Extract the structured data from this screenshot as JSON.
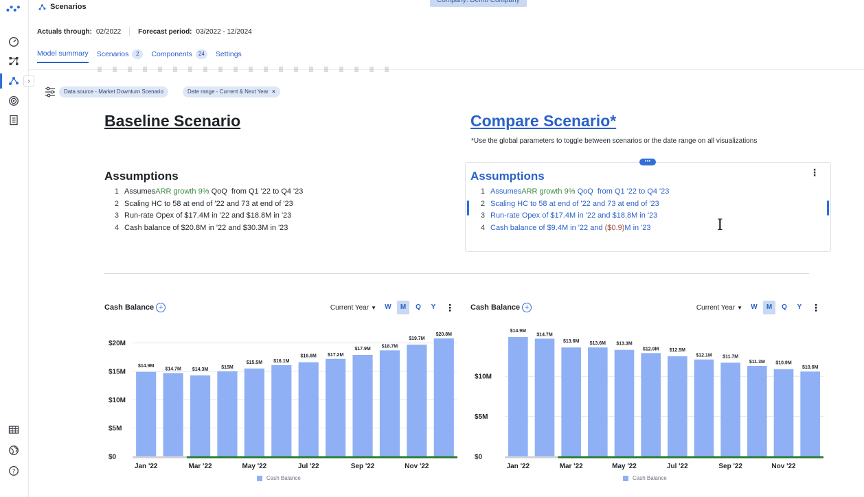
{
  "header": {
    "title": "Scenarios",
    "company_badge": "Company: Demo Company",
    "actuals_label": "Actuals through:",
    "actuals_value": "02/2022",
    "forecast_label": "Forecast period:",
    "forecast_value": "03/2022 - 12/2024"
  },
  "tabs": [
    {
      "label": "Model summary",
      "count": null
    },
    {
      "label": "Scenarios",
      "count": "2"
    },
    {
      "label": "Components",
      "count": "24"
    },
    {
      "label": "Settings",
      "count": null
    }
  ],
  "filters": {
    "chip1": "Data source - Market Downturn Scenario",
    "chip2": "Date range - Current & Next Year",
    "chip2_close": "×"
  },
  "baseline": {
    "title": "Baseline Scenario",
    "assumptions_title": "Assumptions",
    "items": [
      {
        "num": "1",
        "pre": "Assumes ",
        "highlight": "ARR growth 9%",
        "post": " QoQ  from Q1 '22 to Q4 '23"
      },
      {
        "num": "2",
        "text": "Scaling HC to 58 at end of '22 and 73 at end of '23"
      },
      {
        "num": "3",
        "text": "Run-rate Opex of $17.4M in '22 and $18.8M in '23"
      },
      {
        "num": "4",
        "text": "Cash balance of $20.8M in '22 and $30.3M in '23"
      }
    ]
  },
  "compare": {
    "title": "Compare Scenario*",
    "note": "*Use the global parameters to toggle between scenarios or the date range on all visualizations",
    "assumptions_title": "Assumptions",
    "items": [
      {
        "num": "1",
        "pre": "Assumes ",
        "highlight": "ARR growth 9%",
        "post": " QoQ  from Q1 '22 to Q4 '23"
      },
      {
        "num": "2",
        "text": "Scaling HC to 58 at end of '22 and 73 at end of '23"
      },
      {
        "num": "3",
        "text": "Run-rate Opex of $17.4M in '22 and $18.8M in '23"
      },
      {
        "num": "4",
        "pre": "Cash balance of $9.4M in '22 and ",
        "neg": "($0.9)",
        "post": "M in '23"
      }
    ],
    "handle_dots": "•••"
  },
  "chart_controls": {
    "range": "Current Year",
    "periods": [
      "W",
      "M",
      "Q",
      "Y"
    ],
    "active_period": "M"
  },
  "colors": {
    "bar": "#8fb0f5",
    "actuals_line": "#2e7d32",
    "accent": "#2a62c8"
  },
  "chart_data": [
    {
      "type": "bar",
      "title": "Cash Balance",
      "series": [
        {
          "name": "Cash Balance",
          "values": [
            14.9,
            14.7,
            14.3,
            15.0,
            15.5,
            16.1,
            16.6,
            17.2,
            17.9,
            18.7,
            19.7,
            20.8
          ]
        }
      ],
      "categories": [
        "Jan '22",
        "Feb '22",
        "Mar '22",
        "Apr '22",
        "May '22",
        "Jun '22",
        "Jul '22",
        "Aug '22",
        "Sep '22",
        "Oct '22",
        "Nov '22",
        "Dec '22"
      ],
      "x_tick_labels": [
        "Jan '22",
        "Mar '22",
        "May '22",
        "Jul '22",
        "Sep '22",
        "Nov '22"
      ],
      "data_labels": [
        "$14.9M",
        "$14.7M",
        "$14.3M",
        "$15M",
        "$15.5M",
        "$16.1M",
        "$16.6M",
        "$17.2M",
        "$17.9M",
        "$18.7M",
        "$19.7M",
        "$20.8M"
      ],
      "y_ticks": [
        0,
        5,
        10,
        15,
        20
      ],
      "y_tick_labels": [
        "$0",
        "$5M",
        "$10M",
        "$15M",
        "$20M"
      ],
      "ylim": [
        0,
        20.8
      ],
      "legend": "bottom",
      "grid": true
    },
    {
      "type": "bar",
      "title": "Cash Balance",
      "series": [
        {
          "name": "Cash Balance",
          "values": [
            14.9,
            14.7,
            13.6,
            13.6,
            13.3,
            12.9,
            12.5,
            12.1,
            11.7,
            11.3,
            10.9,
            10.6
          ]
        }
      ],
      "categories": [
        "Jan '22",
        "Feb '22",
        "Mar '22",
        "Apr '22",
        "May '22",
        "Jun '22",
        "Jul '22",
        "Aug '22",
        "Sep '22",
        "Oct '22",
        "Nov '22",
        "Dec '22"
      ],
      "x_tick_labels": [
        "Jan '22",
        "Mar '22",
        "May '22",
        "Jul '22",
        "Sep '22",
        "Nov '22"
      ],
      "data_labels": [
        "$14.9M",
        "$14.7M",
        "$13.6M",
        "$13.6M",
        "$13.3M",
        "$12.9M",
        "$12.5M",
        "$12.1M",
        "$11.7M",
        "$11.3M",
        "$10.9M",
        "$10.6M"
      ],
      "y_ticks": [
        0,
        5,
        10
      ],
      "y_tick_labels": [
        "$0",
        "$5M",
        "$10M"
      ],
      "ylim": [
        0,
        14.9
      ],
      "legend": "bottom",
      "grid": true
    }
  ]
}
